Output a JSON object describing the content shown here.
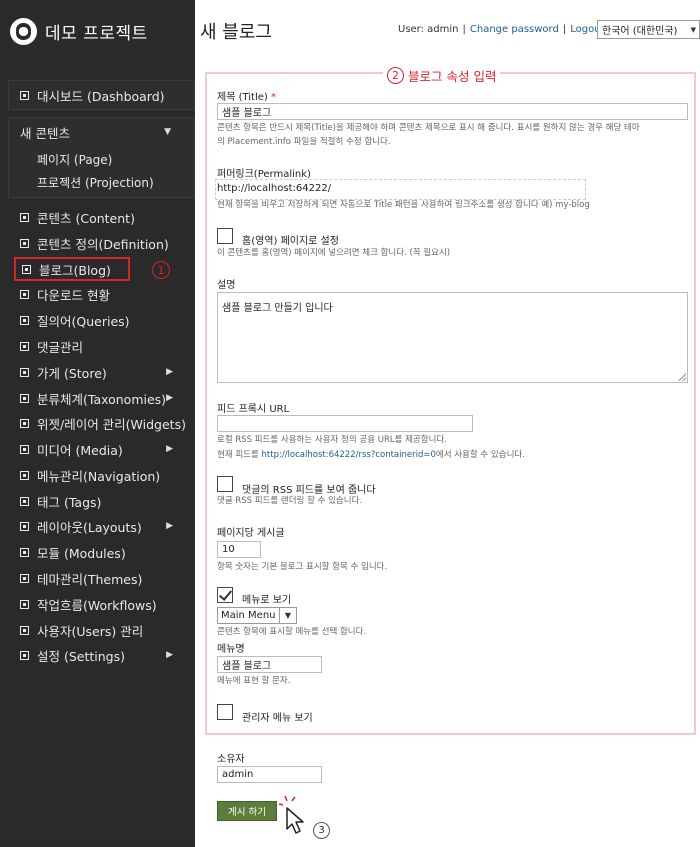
{
  "app": {
    "title": "데모 프로젝트"
  },
  "sidebar": {
    "dashboard": "대시보드 (Dashboard)",
    "new_content": {
      "label": "새 콘텐츠",
      "children": [
        "페이지 (Page)",
        "프로젝션 (Projection)"
      ]
    },
    "items": [
      {
        "label": "콘텐츠 (Content)",
        "has_arrow": false
      },
      {
        "label": "콘텐츠 정의(Definition)",
        "has_arrow": false
      },
      {
        "label": "블로그(Blog)",
        "has_arrow": false,
        "active": true
      },
      {
        "label": "다운로드 현황",
        "has_arrow": false
      },
      {
        "label": "질의어(Queries)",
        "has_arrow": false
      },
      {
        "label": "댓글관리",
        "has_arrow": false
      },
      {
        "label": "가게 (Store)",
        "has_arrow": true
      },
      {
        "label": "분류체계(Taxonomies)",
        "has_arrow": true
      },
      {
        "label": "위젯/레이어 관리(Widgets)",
        "has_arrow": false
      },
      {
        "label": "미디어 (Media)",
        "has_arrow": true
      },
      {
        "label": "메뉴관리(Navigation)",
        "has_arrow": false
      },
      {
        "label": "태그 (Tags)",
        "has_arrow": false
      },
      {
        "label": "레이아웃(Layouts)",
        "has_arrow": true
      },
      {
        "label": "모듈 (Modules)",
        "has_arrow": false
      },
      {
        "label": "테마관리(Themes)",
        "has_arrow": false
      },
      {
        "label": "작업흐름(Workflows)",
        "has_arrow": false
      },
      {
        "label": "사용자(Users) 관리",
        "has_arrow": false
      },
      {
        "label": "설정 (Settings)",
        "has_arrow": true
      }
    ],
    "callout": "1"
  },
  "header": {
    "page_title": "새 블로그",
    "user_text": "User: admin",
    "change_password": "Change password",
    "logout": "Logout",
    "language": "한국어 (대한민국)"
  },
  "form": {
    "callout_number": "2",
    "callout_text": "블로그 속성 입력",
    "title_label": "제목 (Title)",
    "required_mark": "*",
    "title_value": "샘플 블로그",
    "title_hint_1": "콘텐츠 항목은 반드시 제목(Title)을 제공해야 하며 콘텐츠 제목으로 표시 해 줍니다. 표시를 원하지 않는 경우 해당 테마",
    "title_hint_2": "의 Placement.info 파일을 적절히 수정 합니다.",
    "permalink_label": "퍼머링크(Permalink)",
    "permalink_value": "http://localhost:64222/",
    "permalink_hint": "현재 항목을 비우고 저장하게 되면 자동으로 Title 패턴을 사용하여 링크주소를 생성 합니다 예) my-blog",
    "home_page_label": "홈(영역) 페이지로 설정",
    "home_page_checked": false,
    "home_page_hint": "이 콘텐츠를 홈(영역) 페이지에 넣으려면 체크 합니다. (꼭 필요시)",
    "description_label": "설명",
    "description_value": "샘플 블로그 만들기 입니다",
    "feed_proxy_label": "피드 프록시 URL",
    "feed_proxy_value": "",
    "feed_hint_1": "로컬 RSS 피드를 사용하는 사용자 정의 공용 URL를 제공합니다.",
    "feed_hint_2_prefix": "현재 피드를 ",
    "feed_hint_2_link": "http://localhost:64222/rss?containerid=0",
    "feed_hint_2_suffix": "에서 사용할 수 있습니다.",
    "comment_rss_label": "댓글의 RSS 피드를 보여 줍니다",
    "comment_rss_checked": false,
    "comment_rss_hint": "댓글 RSS 피드를 렌더링 할 수 있습니다.",
    "per_page_label": "페이지당 게시글",
    "per_page_value": "10",
    "per_page_hint": "항목 숫자는 기본 블로그 표시할 항목 수 입니다.",
    "show_menu_label": "메뉴로 보기",
    "show_menu_checked": true,
    "menu_select_value": "Main Menu",
    "menu_hint": "콘텐츠 항목에 표시할 메뉴를 선택 합니다.",
    "menu_name_label": "메뉴명",
    "menu_name_value": "샘플 블로그",
    "menu_name_hint": "메뉴에 표현 할 문자.",
    "admin_menu_label": "관리자 메뉴 보기",
    "admin_menu_checked": false
  },
  "owner": {
    "label": "소유자",
    "value": "admin"
  },
  "actions": {
    "publish_label": "게시 하기",
    "callout_number": "3"
  },
  "colors": {
    "sidebar_bg": "#2a2a2a",
    "accent_red": "#d9242b",
    "link_blue": "#1e5a99",
    "publish_green": "#5d7d3b"
  }
}
